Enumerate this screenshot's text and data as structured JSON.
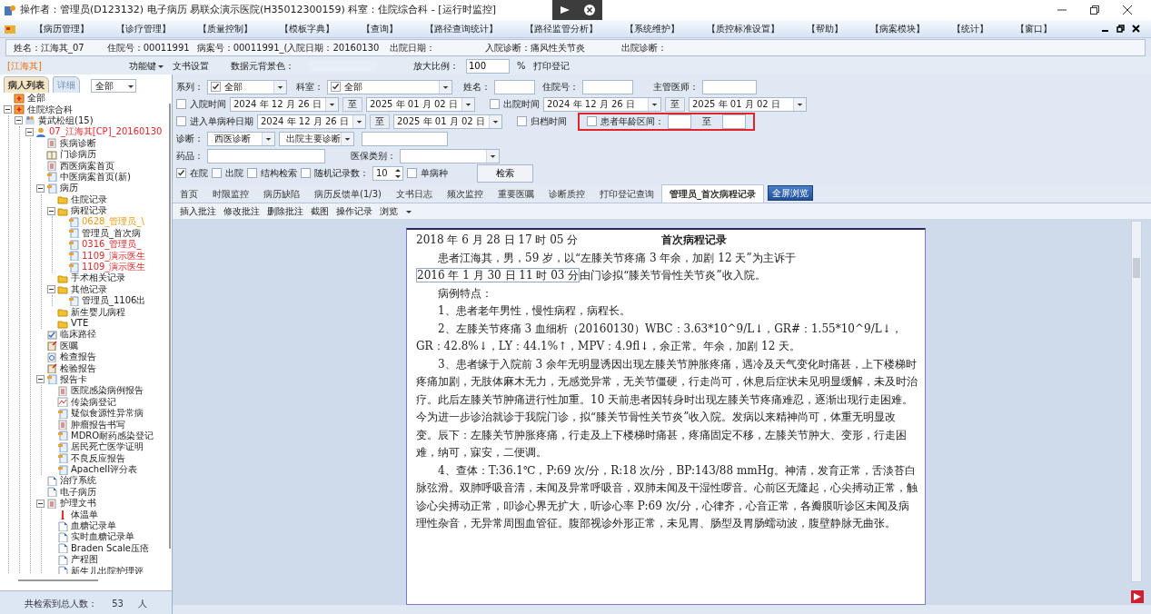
{
  "window": {
    "title": "操作者：管理员(D123132) 电子病历  易联众演示医院(H35012300159)  科室：住院综合科 - [运行时监控]"
  },
  "menu": [
    "【病历管理】",
    "【诊疗管理】",
    "【质量控制】",
    "【模板字典】",
    "【查询】",
    "【路径查询统计】",
    "【路径监管分析】",
    "【系统维护】",
    "【质控标准设置】",
    "【帮助】",
    "【病案模块】",
    "【统计】",
    "【窗口】"
  ],
  "patient_bar": [
    "姓名：江海其_07",
    "住院号：00011991",
    "病案号：00011991_(",
    "入院日期：20160130",
    "出院日期：",
    "入院诊断：痛风性关节炎",
    "出院诊断："
  ],
  "toolbar": {
    "patient_tag": "[江海其]",
    "function_key": "功能键",
    "doc_settings": "文书设置",
    "bg_color_label": "数据元背景色：",
    "zoom_label": "放大比例：",
    "zoom_value": "100",
    "zoom_unit": "%",
    "print_log": "打印登记"
  },
  "left_panel": {
    "tabs": [
      {
        "label": "病人列表",
        "selected": true
      },
      {
        "label": "详细",
        "selected": false
      }
    ],
    "filter": "全部",
    "tree": [
      {
        "label": "全部",
        "kind": "hospital"
      },
      {
        "label": "住院综合科",
        "kind": "hospital",
        "expanded": true,
        "children": [
          {
            "label": "黄武松组(15)",
            "kind": "group",
            "expanded": true,
            "children": [
              {
                "label": "07_江海其[CP]_20160130",
                "kind": "patient",
                "color": "#e02828",
                "expanded": true,
                "children": [
                  {
                    "label": "疾病诊断",
                    "kind": "form"
                  },
                  {
                    "label": "门诊病历",
                    "kind": "book"
                  },
                  {
                    "label": "西医病案首页",
                    "kind": "form"
                  },
                  {
                    "label": "中医病案首页(新)",
                    "kind": "doc"
                  },
                  {
                    "label": "病历",
                    "kind": "doc",
                    "expanded": true,
                    "children": [
                      {
                        "label": "住院记录",
                        "kind": "folder"
                      },
                      {
                        "label": "病程记录",
                        "kind": "folder",
                        "expanded": true,
                        "children": [
                          {
                            "label": "0628_管理员_\\",
                            "kind": "doc",
                            "color": "#f09a10"
                          },
                          {
                            "label": "管理员_首次病",
                            "kind": "doc"
                          },
                          {
                            "label": "0316_管理员_",
                            "kind": "doc",
                            "color": "#e02828"
                          },
                          {
                            "label": "1109_演示医生",
                            "kind": "doc",
                            "color": "#e02828"
                          },
                          {
                            "label": "1109_演示医生",
                            "kind": "doc",
                            "color": "#e02828"
                          }
                        ]
                      },
                      {
                        "label": "手术相关记录",
                        "kind": "folder"
                      },
                      {
                        "label": "其他记录",
                        "kind": "folder",
                        "expanded": true,
                        "children": [
                          {
                            "label": "管理员_1106出",
                            "kind": "doc"
                          }
                        ]
                      },
                      {
                        "label": "新生婴儿病程",
                        "kind": "folder"
                      },
                      {
                        "label": "VTE",
                        "kind": "folder"
                      }
                    ]
                  },
                  {
                    "label": "临床路径",
                    "kind": "path"
                  },
                  {
                    "label": "医嘱",
                    "kind": "order"
                  },
                  {
                    "label": "检查报告",
                    "kind": "search"
                  },
                  {
                    "label": "检验报告",
                    "kind": "order"
                  },
                  {
                    "label": "报告卡",
                    "kind": "doc",
                    "expanded": true,
                    "children": [
                      {
                        "label": "医院感染病例报告",
                        "kind": "form"
                      },
                      {
                        "label": "传染病登记",
                        "kind": "chart"
                      },
                      {
                        "label": "疑似食源性异常病",
                        "kind": "doc"
                      },
                      {
                        "label": "肿瘤报告书写",
                        "kind": "form"
                      },
                      {
                        "label": "MDRO耐药感染登记",
                        "kind": "doc"
                      },
                      {
                        "label": "居民死亡医学证明",
                        "kind": "doc"
                      },
                      {
                        "label": "不良反应报告",
                        "kind": "doc"
                      },
                      {
                        "label": "ApacheII评分表",
                        "kind": "doc"
                      }
                    ]
                  },
                  {
                    "label": "治疗系统",
                    "kind": "page"
                  },
                  {
                    "label": "电子病历",
                    "kind": "page"
                  },
                  {
                    "label": "护理文书",
                    "kind": "form",
                    "expanded": true,
                    "children": [
                      {
                        "label": "体温单",
                        "kind": "thermo"
                      },
                      {
                        "label": "血糖记录单",
                        "kind": "page"
                      },
                      {
                        "label": "实时血糖记录单",
                        "kind": "page"
                      },
                      {
                        "label": "Braden Scale压疮",
                        "kind": "page"
                      },
                      {
                        "label": "产程图",
                        "kind": "page"
                      },
                      {
                        "label": "新生儿出院护理评",
                        "kind": "page"
                      }
                    ]
                  }
                ]
              }
            ]
          }
        ]
      }
    ],
    "status": {
      "label": "共检索到总人数：",
      "count": "53",
      "unit": "人"
    }
  },
  "search_form": [
    [
      {
        "kind": "label",
        "text": "系列："
      },
      {
        "kind": "combo",
        "value": "全部",
        "checked": true
      },
      {
        "kind": "label",
        "text": "科室："
      },
      {
        "kind": "combo",
        "value": "全部",
        "checked": true
      },
      {
        "kind": "label",
        "text": "姓名："
      },
      {
        "kind": "input"
      },
      {
        "kind": "label",
        "text": "住院号："
      },
      {
        "kind": "input"
      },
      {
        "kind": "label",
        "text": "主管医师："
      },
      {
        "kind": "input"
      }
    ],
    [
      {
        "kind": "check",
        "label": "入院时间",
        "checked": false
      },
      {
        "kind": "date",
        "value": "2024 年 12 月 26 日"
      },
      {
        "kind": "to",
        "label": "至"
      },
      {
        "kind": "date",
        "value": "2025 年 01 月 02 日"
      },
      {
        "kind": "check",
        "label": "出院时间",
        "checked": false
      },
      {
        "kind": "date",
        "value": "2024 年 12 月 26 日"
      },
      {
        "kind": "to",
        "label": "至"
      },
      {
        "kind": "date",
        "value": "2025 年 01 月 02 日"
      }
    ],
    [
      {
        "kind": "check",
        "label": "进入单病种日期",
        "checked": false
      },
      {
        "kind": "date",
        "value": "2024 年 12 月 26 日"
      },
      {
        "kind": "to",
        "label": "至"
      },
      {
        "kind": "date",
        "value": "2025 年 01 月 02 日"
      },
      {
        "kind": "check",
        "label": "归档时间",
        "checked": false
      },
      {
        "kind": "range",
        "label": "患者年龄区间：",
        "to": "至",
        "checked": false,
        "highlighted": true
      }
    ],
    [
      {
        "kind": "label",
        "text": "诊断："
      },
      {
        "kind": "combo",
        "value": "西医诊断"
      },
      {
        "kind": "combo",
        "value": "出院主要诊断"
      },
      {
        "kind": "input"
      }
    ],
    [
      {
        "kind": "label",
        "text": "药品："
      },
      {
        "kind": "input"
      },
      {
        "kind": "label",
        "text": "医保类别："
      },
      {
        "kind": "combo"
      }
    ],
    [
      {
        "kind": "check",
        "label": "在院",
        "checked": true
      },
      {
        "kind": "check",
        "label": "出院",
        "checked": false
      },
      {
        "kind": "check",
        "label": "结构检索",
        "checked": false
      },
      {
        "kind": "check",
        "label": "随机记录数：",
        "checked": false
      },
      {
        "kind": "spin",
        "value": "10"
      },
      {
        "kind": "check",
        "label": "单病种",
        "checked": false
      },
      {
        "kind": "button",
        "label": "检索"
      }
    ]
  ],
  "doc_tabs": [
    {
      "label": "首页",
      "selected": false
    },
    {
      "label": "时限监控",
      "selected": false
    },
    {
      "label": "病历缺陷",
      "selected": false
    },
    {
      "label": "病历反馈单(1/3)",
      "selected": false
    },
    {
      "label": "文书日志",
      "selected": false
    },
    {
      "label": "频次监控",
      "selected": false
    },
    {
      "label": "重要医嘱",
      "selected": false
    },
    {
      "label": "诊断质控",
      "selected": false
    },
    {
      "label": "打印登记查询",
      "selected": false
    },
    {
      "label": "管理员_首次病程记录",
      "selected": true
    }
  ],
  "fullscreen_button": "全屏浏览",
  "doc_toolbar": [
    "插入批注",
    "修改批注",
    "删除批注",
    "截图",
    "操作记录",
    "浏览"
  ],
  "document": {
    "datetime": "2018 年 6 月 28 日 17 时 05 分",
    "heading": "首次病程记录",
    "paragraphs": [
      [
        {
          "text": "患者江海其，男，59 岁，以“左膝关节疼痛 3 年余，加剧 12 天”为主诉于"
        },
        {
          "text": "2016 年 1 月 30 日 11 时 03 分",
          "field": true
        },
        {
          "text": "由门诊拟“膝关节骨性关节炎”收入院。"
        }
      ],
      [
        {
          "text": "病例特点："
        }
      ],
      [
        {
          "text": "1、患者老年男性，慢性病程，病程长。"
        }
      ],
      [
        {
          "text": "2、左膝关节疼痛 3 血细析（20160130）WBC：3.63*10^9/L↓，GR#：1.55*10^9/L↓，GR：42.8%↓，LY：44.1%↑，MPV：4.9fl↓，余正常。年余，加剧 12 天。"
        }
      ],
      [
        {
          "text": "3、患者缘于入院前 3 余年无明显诱因出现左膝关节肿胀疼痛，遇冷及天气变化时痛甚，上下楼梯时疼痛加剧，无肢体麻木无力，无感觉异常，无关节僵硬，行走尚可，休息后症状未见明显缓解，未及时治疗。此后左膝关节肿痛进行性加重。10 天前患者因转身时出现左膝关节疼痛难忍，逐渐出现行走困难。今为进一步诊治就诊于我院门诊，拟“膝关节骨性关节炎”收入院。发病以来精神尚可，体重无明显改变。辰下：左膝关节肿胀疼痛，行走及上下楼梯时痛甚，疼痛固定不移，左膝关节肿大、变形，行走困难，纳可，寐安，二便调。"
        }
      ],
      [
        {
          "text": "4、查体：T:36.1℃，P:69 次/分，R:18 次/分，BP:143/88 mmHg。神清，发育正常，舌淡苔白脉弦滑。双肺呼吸音清，未闻及异常呼吸音，双肺未闻及干湿性啰音。心前区无隆起，心尖搏动正常，触诊心尖搏动正常，叩诊心界无扩大，听诊心率 P:69 次/分，心律齐，心音正常，各瓣膜听诊区未闻及病理性杂音，无异常周围血管征。腹部视诊外形正常，未见胃、肠型及胃肠蠕动波，腹壁静脉无曲张。"
        }
      ]
    ]
  }
}
